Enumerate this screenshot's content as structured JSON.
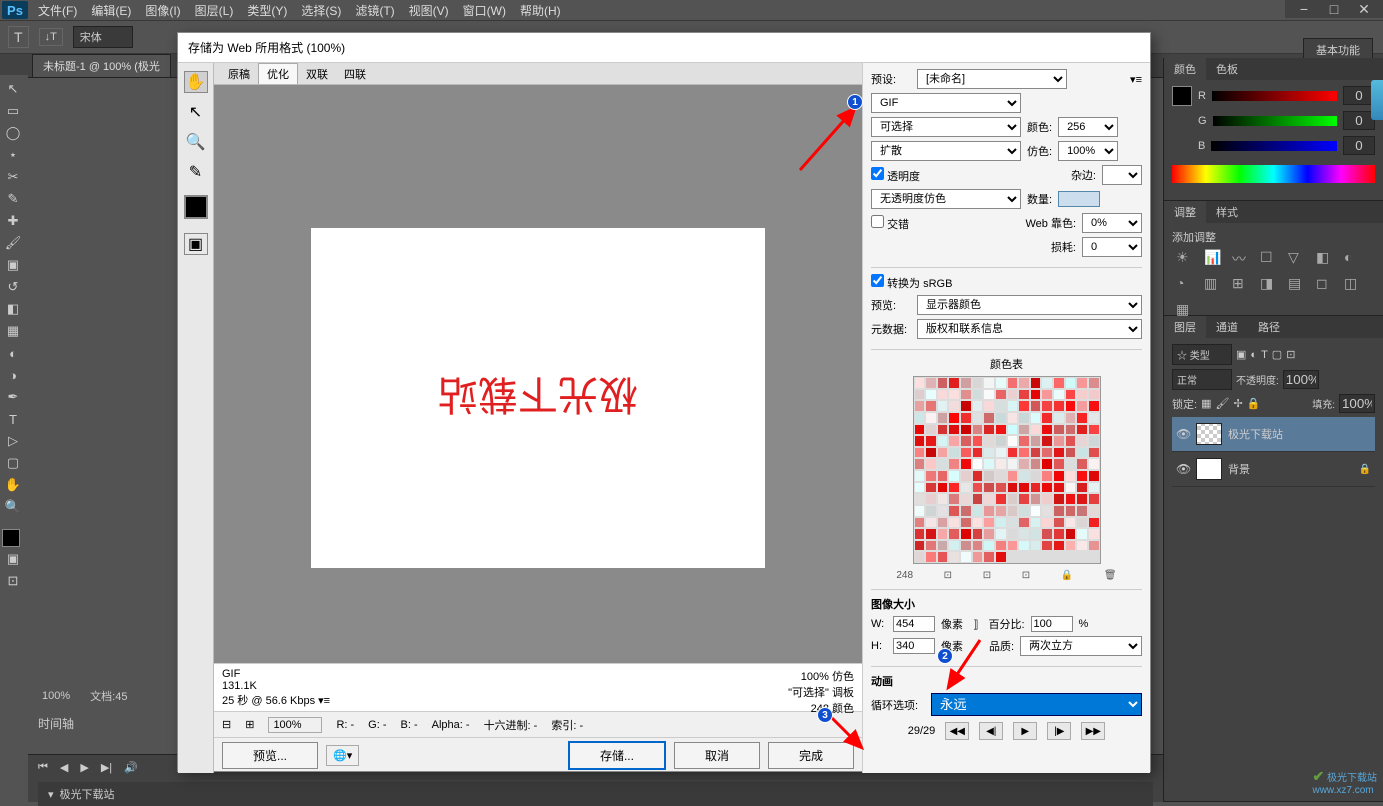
{
  "app": {
    "logo": "Ps"
  },
  "menu": [
    "文件(F)",
    "编辑(E)",
    "图像(I)",
    "图层(L)",
    "类型(Y)",
    "选择(S)",
    "滤镜(T)",
    "视图(V)",
    "窗口(W)",
    "帮助(H)"
  ],
  "optbar": {
    "tool": "T",
    "font": "宋体"
  },
  "workspace_btn": "基本功能",
  "doc_tab": "未标题-1 @ 100% (极光",
  "status": {
    "zoom": "100%",
    "doc": "文档:45"
  },
  "timeline_label": "时间轴",
  "timeline_item": "极光下载站",
  "panels": {
    "color": {
      "tab1": "颜色",
      "tab2": "色板",
      "r": "R",
      "g": "G",
      "b": "B",
      "rv": "0",
      "gv": "0",
      "bv": "0"
    },
    "adjust": {
      "tab1": "调整",
      "tab2": "样式",
      "title": "添加调整"
    },
    "layers": {
      "tab1": "图层",
      "tab2": "通道",
      "tab3": "路径",
      "kind": "☆ 类型",
      "mode": "正常",
      "opacity_label": "不透明度:",
      "opacity": "100%",
      "lock_label": "锁定:",
      "fill_label": "填充:",
      "fill": "100%",
      "layer1": "极光下载站",
      "layer2": "背景"
    }
  },
  "dialog": {
    "title": "存储为 Web 所用格式 (100%)",
    "tabs": [
      "原稿",
      "优化",
      "双联",
      "四联"
    ],
    "canvas_text": "极光下载站",
    "info_left": {
      "line1": "GIF",
      "line2": "131.1K",
      "line3": "25 秒 @ 56.6 Kbps  ▾≡"
    },
    "info_right": {
      "line1": "100% 仿色",
      "line2": "\"可选择\" 调板",
      "line3": "248 颜色"
    },
    "status": {
      "zoom": "100%",
      "r": "R:  -",
      "g": "G:  -",
      "b": "B:  -",
      "alpha": "Alpha: -",
      "hex": "十六进制: -",
      "index": "索引: -"
    },
    "buttons": {
      "preview": "预览...",
      "save": "存储...",
      "cancel": "取消",
      "done": "完成"
    },
    "right": {
      "preset_label": "预设:",
      "preset": "[未命名]",
      "format": "GIF",
      "reduction": "可选择",
      "colors_label": "颜色:",
      "colors": "256",
      "dither_method": "扩散",
      "dither_label": "仿色:",
      "dither": "100%",
      "transparency": "透明度",
      "matte_label": "杂边:",
      "trans_dither": "无透明度仿色",
      "amount_label": "数量:",
      "interlace": "交错",
      "web_label": "Web 靠色:",
      "web": "0%",
      "lossy_label": "损耗:",
      "lossy": "0",
      "srgb": "转换为 sRGB",
      "preview_label": "预览:",
      "preview_val": "显示器颜色",
      "meta_label": "元数据:",
      "meta_val": "版权和联系信息",
      "color_table_title": "颜色表",
      "ct_count": "248",
      "size_title": "图像大小",
      "w_label": "W:",
      "w": "454",
      "px1": "像素",
      "h_label": "H:",
      "h": "340",
      "px2": "像素",
      "percent_label": "百分比:",
      "percent": "100",
      "pct": "%",
      "quality_label": "品质:",
      "quality_val": "两次立方",
      "anim_title": "动画",
      "loop_label": "循环选项:",
      "loop": "永远",
      "frame_pos": "29/29"
    }
  },
  "watermark": {
    "brand": "极光下载站",
    "url": "www.xz7.com"
  }
}
